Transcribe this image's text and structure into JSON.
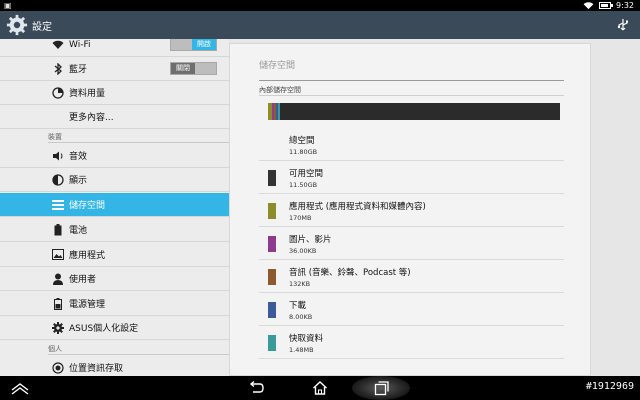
{
  "status_bar": {
    "time": "9:32"
  },
  "action_bar": {
    "title": "設定",
    "icon": "settings-gear-icon"
  },
  "settings_list": {
    "wifi": {
      "label": "Wi-Fi",
      "toggle": "開啟"
    },
    "bluetooth": {
      "label": "藍牙",
      "toggle": "關閉"
    },
    "data_usage": {
      "label": "資料用量"
    },
    "more": {
      "label": "更多內容..."
    },
    "header_device": "裝置",
    "sound": {
      "label": "音效"
    },
    "display": {
      "label": "顯示"
    },
    "storage": {
      "label": "儲存空間"
    },
    "battery": {
      "label": "電池"
    },
    "apps": {
      "label": "應用程式"
    },
    "users": {
      "label": "使用者"
    },
    "power": {
      "label": "電源管理"
    },
    "asus": {
      "label": "ASUS個人化設定"
    },
    "header_personal": "個人",
    "location": {
      "label": "位置資訊存取"
    }
  },
  "storage_panel": {
    "title": "儲存空間",
    "section": "內部儲存空間",
    "bar_segments": [
      {
        "name": "apps",
        "fraction": 0.014,
        "color": "#8c8c2a"
      },
      {
        "name": "pictures",
        "fraction": 0.006,
        "color": "#8e3a8e"
      },
      {
        "name": "audio",
        "fraction": 0.007,
        "color": "#8c5a2e"
      },
      {
        "name": "downloads",
        "fraction": 0.004,
        "color": "#3a5a9a"
      },
      {
        "name": "cache",
        "fraction": 0.007,
        "color": "#3a9a9a"
      }
    ],
    "items": [
      {
        "name": "總空間",
        "size": "11.80GB",
        "color": ""
      },
      {
        "name": "可用空間",
        "size": "11.50GB",
        "color": "#333333"
      },
      {
        "name": "應用程式 (應用程式資料和媒體內容)",
        "size": "170MB",
        "color": "#8c8c2a"
      },
      {
        "name": "圖片、影片",
        "size": "36.00KB",
        "color": "#8e3a8e"
      },
      {
        "name": "音訊 (音樂、鈴聲、Podcast 等)",
        "size": "132KB",
        "color": "#8c5a2e"
      },
      {
        "name": "下載",
        "size": "8.00KB",
        "color": "#3a5a9a"
      },
      {
        "name": "快取資料",
        "size": "1.48MB",
        "color": "#3a9a9a"
      }
    ]
  },
  "watermark": "#1912969"
}
